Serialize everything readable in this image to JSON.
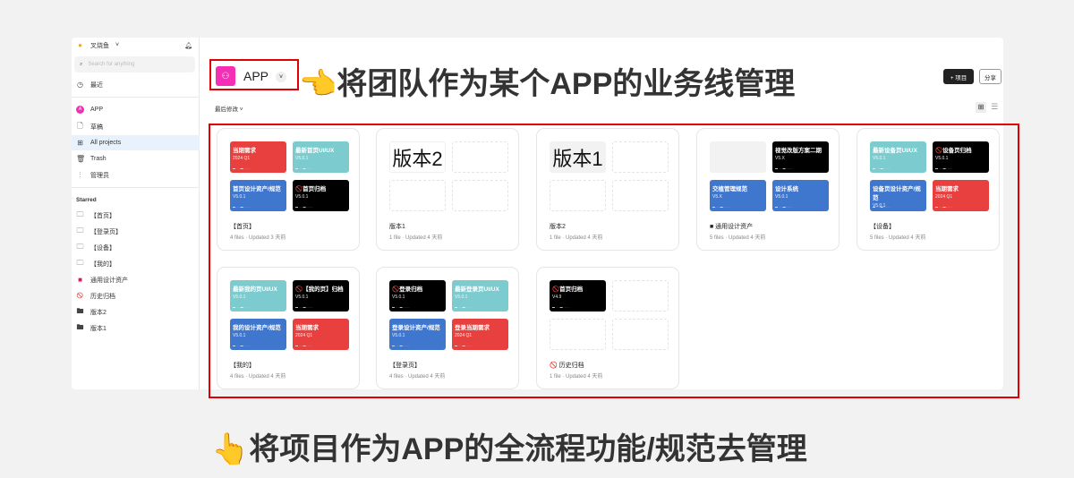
{
  "sidebar": {
    "workspace": "叉烧鱼",
    "search_placeholder": "Search for anything",
    "recent": "最近",
    "team": "APP",
    "drafts": "草稿",
    "all_projects": "All projects",
    "trash": "Trash",
    "admin": "管理员",
    "starred_heading": "Starred",
    "starred": [
      {
        "label": "【首页】",
        "icon": "folder-outline"
      },
      {
        "label": "【登录页】",
        "icon": "folder-outline"
      },
      {
        "label": "【设备】",
        "icon": "folder-outline"
      },
      {
        "label": "【我的】",
        "icon": "folder-outline"
      },
      {
        "label": "通用设计资产",
        "icon": "red-square"
      },
      {
        "label": "历史归档",
        "icon": "prohibited"
      },
      {
        "label": "版本2",
        "icon": "folder"
      },
      {
        "label": "版本1",
        "icon": "folder"
      }
    ]
  },
  "header": {
    "project_icon": "team-icon",
    "project_name": "APP",
    "sort_label": "最后修改 ˅",
    "new_button": "+ 项目",
    "share_button": "分享"
  },
  "colors": {
    "red": "#e8403f",
    "teal": "#7ccbcf",
    "blue": "#3f76ce",
    "black": "#000000",
    "accent": "#f42fb5"
  },
  "cards": [
    {
      "title": "【首页】",
      "meta": "4 files · Updated 3 天前",
      "thumbs": [
        {
          "c": "red",
          "t": "当期需求",
          "v": "2024 Q1"
        },
        {
          "c": "teal",
          "t": "最新首页UI/UX",
          "v": "V5.0.1"
        },
        {
          "c": "blue",
          "t": "首页设计资产/规范",
          "v": "V5.0.1"
        },
        {
          "c": "black",
          "t": "🚫首页归档",
          "v": "V5.0.1"
        }
      ]
    },
    {
      "title": "版本1",
      "meta": "1 file · Updated 4 天前",
      "thumbs": [
        {
          "c": "bigw",
          "t": "版本2"
        },
        {
          "c": "empty"
        },
        {
          "c": "empty"
        },
        {
          "c": "empty"
        }
      ]
    },
    {
      "title": "版本2",
      "meta": "1 file · Updated 4 天前",
      "thumbs": [
        {
          "c": "bigg",
          "t": "版本1"
        },
        {
          "c": "empty"
        },
        {
          "c": "empty"
        },
        {
          "c": "empty"
        }
      ]
    },
    {
      "title": "■ 通用设计资产",
      "meta": "5 files · Updated 4 天前",
      "thumbs": [
        {
          "c": "gray"
        },
        {
          "c": "black",
          "t": "视觉改版方案二期",
          "v": "V5.X"
        },
        {
          "c": "blue",
          "t": "交植管理规范",
          "v": "V5.X"
        },
        {
          "c": "blue",
          "t": "设计系统",
          "v": "V5.0.1"
        }
      ]
    },
    {
      "title": "【设备】",
      "meta": "5 files · Updated 4 天前",
      "thumbs": [
        {
          "c": "teal",
          "t": "最新设备页UI/UX",
          "v": "V5.0.1"
        },
        {
          "c": "black",
          "t": "🚫设备页归档",
          "v": "V5.0.1"
        },
        {
          "c": "blue",
          "t": "设备页设计资产/规范",
          "v": "V5.0.1"
        },
        {
          "c": "red",
          "t": "当期需求",
          "v": "2024 Q1"
        }
      ]
    },
    {
      "title": "【我的】",
      "meta": "4 files · Updated 4 天前",
      "thumbs": [
        {
          "c": "teal",
          "t": "最新我的页UI/UX",
          "v": "V5.0.1"
        },
        {
          "c": "black",
          "t": "🚫【我的页】归档",
          "v": "V5.0.1"
        },
        {
          "c": "blue",
          "t": "我的设计资产/规范",
          "v": "V5.0.1"
        },
        {
          "c": "red",
          "t": "当期需求",
          "v": "2024 Q1"
        }
      ]
    },
    {
      "title": "【登录页】",
      "meta": "4 files · Updated 4 天前",
      "thumbs": [
        {
          "c": "black",
          "t": "🚫登录归档",
          "v": "V5.0.1"
        },
        {
          "c": "teal",
          "t": "最新登录页UI/UX",
          "v": "V5.0.1"
        },
        {
          "c": "blue",
          "t": "登录设计资产/规范",
          "v": "V5.0.1"
        },
        {
          "c": "red",
          "t": "登录当期需求",
          "v": "2024 Q1"
        }
      ]
    },
    {
      "title": "🚫 历史归档",
      "meta": "1 file · Updated 4 天前",
      "thumbs": [
        {
          "c": "black",
          "t": "🚫首页归档",
          "v": "V4.9"
        },
        {
          "c": "empty"
        },
        {
          "c": "empty"
        },
        {
          "c": "empty"
        }
      ]
    }
  ],
  "annotations": {
    "top": "👈将团队作为某个APP的业务线管理",
    "bottom": "👆将项目作为APP的全流程功能/规范去管理"
  }
}
